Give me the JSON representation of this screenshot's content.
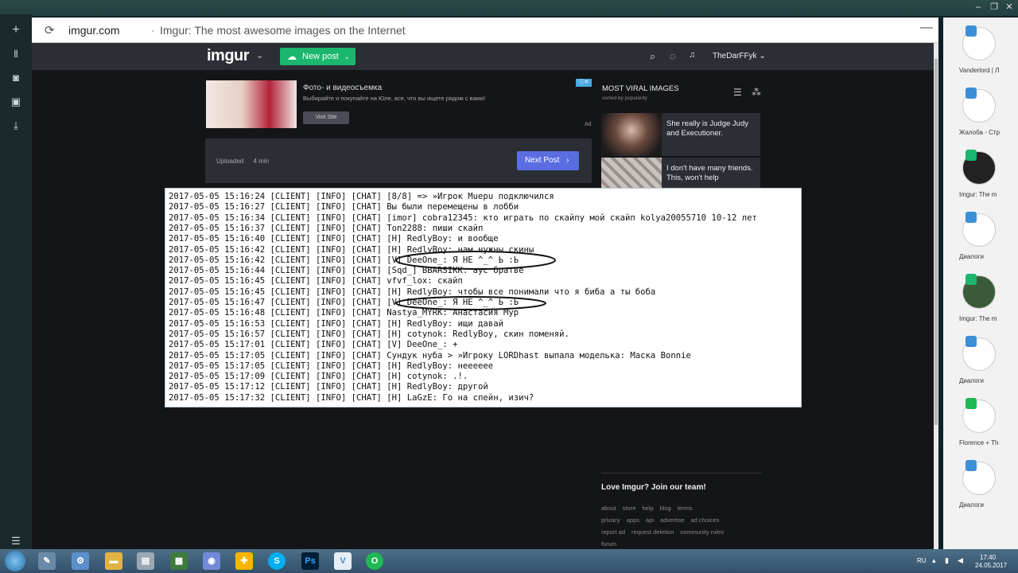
{
  "browser": {
    "host": "imgur.com",
    "separator": "·",
    "title": "Imgur: The most awesome images on the Internet"
  },
  "imgur": {
    "logo": "imgur",
    "new_post": "New post",
    "user": "TheDarFFyk",
    "ad": {
      "title": "Фото- и видеосъемка",
      "subtitle": "Выбирайте и покупайте на Юле, все, что вы ищете рядом с вами!",
      "button": "Visit Site",
      "label": "Ad"
    },
    "uploaded_label": "Uploaded",
    "uploaded_time": "4 min",
    "next_post": "Next Post",
    "viral": {
      "title": "MOST VIRAL IMAGES",
      "subtitle": "sorted by popularity",
      "items": [
        "She really is Judge Judy and Executioner.",
        "I don't have many friends. This, won't help"
      ]
    },
    "join": "Love Imgur? Join our team!",
    "footer": [
      [
        "about",
        "store",
        "help",
        "blog",
        "terms"
      ],
      [
        "privacy",
        "apps",
        "api",
        "advertise",
        "ad choices"
      ],
      [
        "report ad",
        "request deletion",
        "community rules"
      ],
      [
        "forum"
      ]
    ]
  },
  "console": {
    "lines": [
      "2017-05-05 15:16:24 [CLIENT] [INFO] [CHAT] [8/8] => »Игрок Muepu подключился",
      "2017-05-05 15:16:27 [CLIENT] [INFO] [CHAT] Вы были перемещены в лобби",
      "2017-05-05 15:16:34 [CLIENT] [INFO] [CHAT] [imor] cobra12345: кто играть по скайпу мой скайп kolya20055710 10-12 лет",
      "2017-05-05 15:16:37 [CLIENT] [INFO] [CHAT] Ton2288: пиши скайп",
      "2017-05-05 15:16:40 [CLIENT] [INFO] [CHAT] [H] RedlyBoy: и вообще",
      "2017-05-05 15:16:42 [CLIENT] [INFO] [CHAT] [H] RedlyBoy: нам нужны скины",
      "2017-05-05 15:16:42 [CLIENT] [INFO] [CHAT] [V] DeeOne_: Я НЕ ^_^ Ь :Ь",
      "2017-05-05 15:16:44 [CLIENT] [INFO] [CHAT] [Sqd_] BBARSIKK: аус братве",
      "2017-05-05 15:16:45 [CLIENT] [INFO] [CHAT] vfvf_lox: скайп",
      "2017-05-05 15:16:45 [CLIENT] [INFO] [CHAT] [H] RedlyBoy: чтобы все понимали что я биба а ты боба",
      "2017-05-05 15:16:47 [CLIENT] [INFO] [CHAT] [V] DeeOne_: Я НЕ ^_^ Ь :Ь",
      "2017-05-05 15:16:48 [CLIENT] [INFO] [CHAT] Nastya_MYRK: Анастасия Мур",
      "2017-05-05 15:16:53 [CLIENT] [INFO] [CHAT] [H] RedlyBoy: ищи давай",
      "2017-05-05 15:16:57 [CLIENT] [INFO] [CHAT] [H] cotynok: RedlyBoy, скин поменяй.",
      "2017-05-05 15:17:01 [CLIENT] [INFO] [CHAT] [V] DeeOne_: +",
      "2017-05-05 15:17:05 [CLIENT] [INFO] [CHAT] Сундук нуба > »Игроку LORDhast выпала моделька: Маска Bonnie",
      "2017-05-05 15:17:05 [CLIENT] [INFO] [CHAT] [H] RedlyBoy: неееееe",
      "2017-05-05 15:17:09 [CLIENT] [INFO] [CHAT] [H] cotynok: .!.",
      "2017-05-05 15:17:12 [CLIENT] [INFO] [CHAT] [H] RedlyBoy: другой",
      "2017-05-05 15:17:32 [CLIENT] [INFO] [CHAT] [H] LaGzE: Го на спейн, изич?"
    ]
  },
  "tabs": [
    {
      "label": "Vanderlord | Л"
    },
    {
      "label": "Жалоба - Стр"
    },
    {
      "label": "Imgur: The m"
    },
    {
      "label": "Диалоги"
    },
    {
      "label": "Imgur: The m"
    },
    {
      "label": "Диалоги"
    },
    {
      "label": "Florence + Th"
    },
    {
      "label": "Диалоги"
    }
  ],
  "tray": {
    "lang": "RU",
    "time": "17:40",
    "date": "24.05.2017"
  }
}
